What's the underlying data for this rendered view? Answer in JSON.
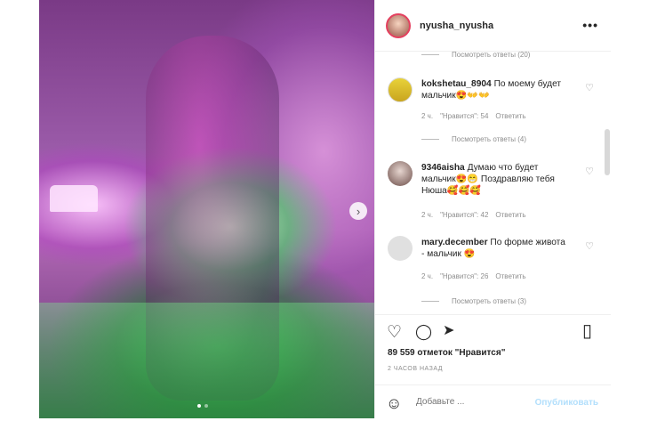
{
  "post": {
    "username": "nyusha_nyusha",
    "more_label": "•••",
    "next_label": "›"
  },
  "comments": {
    "replies": [
      {
        "label": "Посмотреть ответы (20)"
      },
      {
        "label": "Посмотреть ответы (4)"
      },
      {
        "label": "Посмотреть ответы (3)"
      }
    ],
    "items": [
      {
        "user": "kokshetau_8904",
        "text": "По моему будет мальчик😍👐👐",
        "age": "2 ч.",
        "likes": "\"Нравится\": 54",
        "reply": "Ответить"
      },
      {
        "user": "9346aisha",
        "text": "Думаю что будет мальчик😍😁 Поздравляю тебя Нюша🥰🥰🥰",
        "age": "2 ч.",
        "likes": "\"Нравится\": 42",
        "reply": "Ответить"
      },
      {
        "user": "mary.december",
        "text": "По форме живота - мальчик 😍",
        "age": "2 ч.",
        "likes": "\"Нравится\": 26",
        "reply": "Ответить"
      }
    ],
    "heart_icon": "♡"
  },
  "actions": {
    "likes_count": "89 559 отметок \"Нравится\"",
    "posted_ago": "2 ЧАСОВ НАЗАД",
    "like_icon": "♡",
    "comment_icon": "◯",
    "share_icon": "➤",
    "save_icon": "▯"
  },
  "composer": {
    "placeholder": "Добавьте ...",
    "publish_label": "Опубликовать",
    "emoji_icon": "☺"
  },
  "colors": {
    "accent": "#0095f6",
    "publish_disabled": "#b2dffc",
    "border": "#efefef"
  }
}
